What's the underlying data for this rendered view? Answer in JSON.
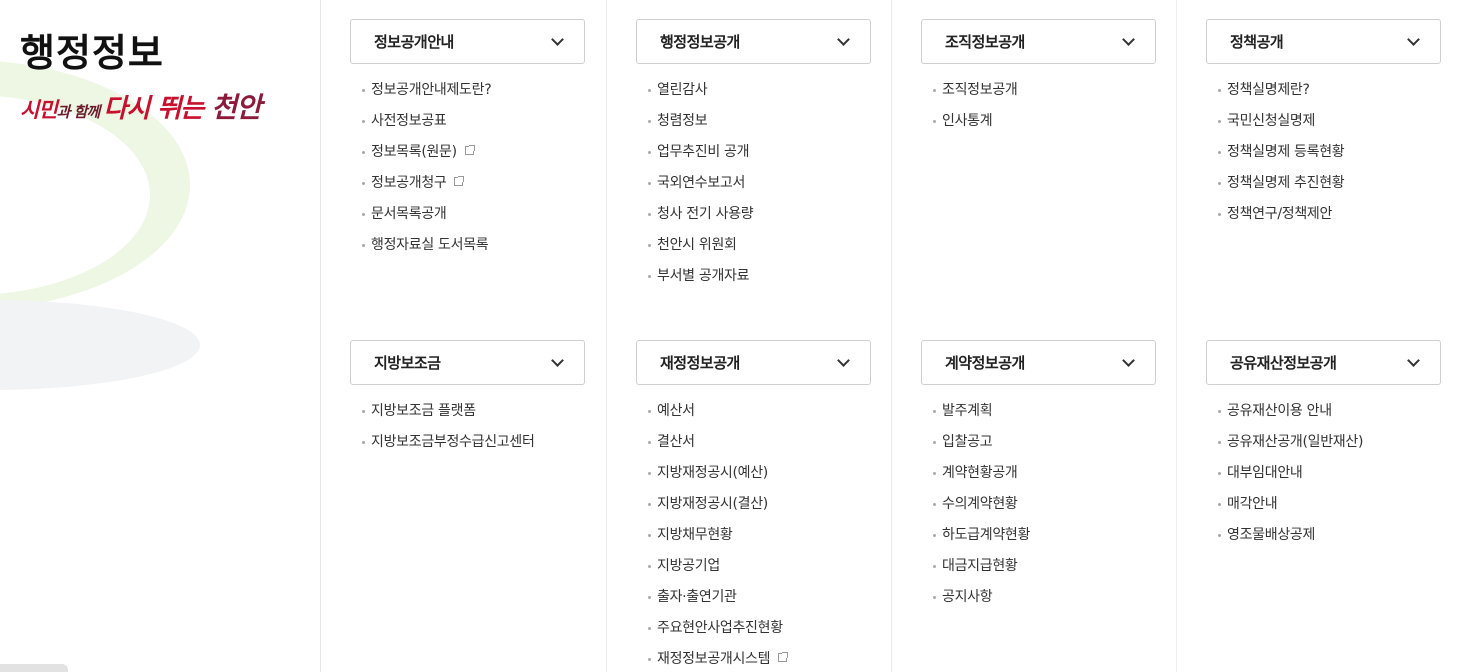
{
  "sidebar": {
    "title": "행정정보",
    "slogan": {
      "part1": "시민",
      "part2": "과 함께 ",
      "part3": "다시 뛰는 ",
      "part4": "천안"
    }
  },
  "columns": [
    {
      "groups": [
        {
          "label": "정보공개안내",
          "items": [
            {
              "label": "정보공개안내제도란?",
              "external": false
            },
            {
              "label": "사전정보공표",
              "external": false
            },
            {
              "label": "정보목록(원문)",
              "external": true
            },
            {
              "label": "정보공개청구",
              "external": true
            },
            {
              "label": "문서목록공개",
              "external": false
            },
            {
              "label": "행정자료실 도서목록",
              "external": false
            }
          ]
        },
        {
          "label": "지방보조금",
          "items": [
            {
              "label": "지방보조금 플랫폼",
              "external": false
            },
            {
              "label": "지방보조금부정수급신고센터",
              "external": false
            }
          ]
        }
      ]
    },
    {
      "groups": [
        {
          "label": "행정정보공개",
          "items": [
            {
              "label": "열린감사",
              "external": false
            },
            {
              "label": "청렴정보",
              "external": false
            },
            {
              "label": "업무추진비 공개",
              "external": false
            },
            {
              "label": "국외연수보고서",
              "external": false
            },
            {
              "label": "청사 전기 사용량",
              "external": false
            },
            {
              "label": "천안시 위원회",
              "external": false
            },
            {
              "label": "부서별 공개자료",
              "external": false
            }
          ]
        },
        {
          "label": "재정정보공개",
          "items": [
            {
              "label": "예산서",
              "external": false
            },
            {
              "label": "결산서",
              "external": false
            },
            {
              "label": "지방재정공시(예산)",
              "external": false
            },
            {
              "label": "지방재정공시(결산)",
              "external": false
            },
            {
              "label": "지방채무현황",
              "external": false
            },
            {
              "label": "지방공기업",
              "external": false
            },
            {
              "label": "출자·출연기관",
              "external": false
            },
            {
              "label": "주요현안사업추진현황",
              "external": false
            },
            {
              "label": "재정정보공개시스템",
              "external": true
            }
          ]
        }
      ]
    },
    {
      "groups": [
        {
          "label": "조직정보공개",
          "items": [
            {
              "label": "조직정보공개",
              "external": false
            },
            {
              "label": "인사통계",
              "external": false
            }
          ]
        },
        {
          "label": "계약정보공개",
          "items": [
            {
              "label": "발주계획",
              "external": false
            },
            {
              "label": "입찰공고",
              "external": false
            },
            {
              "label": "계약현황공개",
              "external": false
            },
            {
              "label": "수의계약현황",
              "external": false
            },
            {
              "label": "하도급계약현황",
              "external": false
            },
            {
              "label": "대금지급현황",
              "external": false
            },
            {
              "label": "공지사항",
              "external": false
            }
          ]
        }
      ]
    },
    {
      "groups": [
        {
          "label": "정책공개",
          "items": [
            {
              "label": "정책실명제란?",
              "external": false
            },
            {
              "label": "국민신청실명제",
              "external": false
            },
            {
              "label": "정책실명제 등록현황",
              "external": false
            },
            {
              "label": "정책실명제 추진현황",
              "external": false
            },
            {
              "label": "정책연구/정책제안",
              "external": false
            }
          ]
        },
        {
          "label": "공유재산정보공개",
          "items": [
            {
              "label": "공유재산이용 안내",
              "external": false
            },
            {
              "label": "공유재산공개(일반재산)",
              "external": false
            },
            {
              "label": "대부임대안내",
              "external": false
            },
            {
              "label": "매각안내",
              "external": false
            },
            {
              "label": "영조물배상공제",
              "external": false
            }
          ]
        }
      ]
    }
  ]
}
